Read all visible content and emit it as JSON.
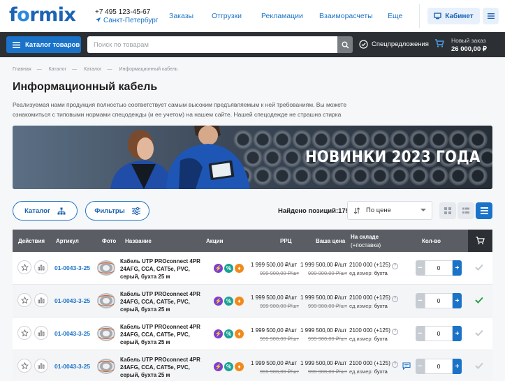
{
  "brand": {
    "logo_pre": "f",
    "logo_o": "o",
    "logo_post": "rmix"
  },
  "contacts": {
    "phone": "+7 495 123-45-67",
    "city": "Санкт-Петербург"
  },
  "nav": {
    "items": [
      "Заказы",
      "Отгрузки",
      "Рекламации",
      "Взаиморасчеты",
      "Еще"
    ]
  },
  "account": {
    "cabinet_label": "Кабинет"
  },
  "toolbar": {
    "catalog_label": "Каталог товаров",
    "search_placeholder": "Поиск по товарам",
    "special_label": "Спецпредложения",
    "order_label": "Новый заказ",
    "order_sum": "26 000,00 ₽"
  },
  "breadcrumbs": [
    "Главная",
    "Каталог",
    "Каталог",
    "Информационный кабель"
  ],
  "page": {
    "title": "Информационный кабель",
    "description": "Реализуемая нами продукция полностью соответствует самым высоким предъявляемым к ней требованиям. Вы можете ознакомиться с типовыми нормами спецодежды (и ее учетом) на нашем сайте. Нашей спецодежде не страшна стирка"
  },
  "banner": {
    "text": "НОВИНКИ 2023 ГОДА"
  },
  "filters": {
    "catalog_label": "Каталог",
    "filters_label": "Фильтры",
    "found_label": "Найдено позиций:",
    "found_count": "179",
    "sort_value": "По цене"
  },
  "table": {
    "headers": {
      "actions": "Действия",
      "sku": "Артикул",
      "photo": "Фото",
      "name": "Название",
      "promo": "Акции",
      "rrp": "РРЦ",
      "your_price": "Ваша цена",
      "stock_line1": "На складе",
      "stock_line2": "(+поставка)",
      "qty": "Кол-во"
    },
    "rows": [
      {
        "sku": "01-0043-3-25",
        "name": "Кабель UTP PROconnect 4PR 24AFG, CCA, CAT5e, PVC, серый, бухта 25 м",
        "rrp": "1 999 500,00 ₽/шт",
        "rrp_old": "999 900,00 ₽/шт",
        "price": "1 999 500,00 ₽/шт",
        "price_old": "999 900,00 ₽/шт",
        "stock": "2100 000 (+125)",
        "unit_label": "ед.измер:",
        "unit": "бухта",
        "qty": "0",
        "in_cart": false,
        "has_chat": false
      },
      {
        "sku": "01-0043-3-25",
        "name": "Кабель UTP PROconnect 4PR 24AFG, CCA, CAT5e, PVC, серый, бухта 25 м",
        "rrp": "1 999 500,00 ₽/шт",
        "rrp_old": "999 900,00 ₽/шт",
        "price": "1 999 500,00 ₽/шт",
        "price_old": "999 900,00 ₽/шт",
        "stock": "2100 000 (+125)",
        "unit_label": "ед.измер:",
        "unit": "бухта",
        "qty": "0",
        "in_cart": true,
        "has_chat": false
      },
      {
        "sku": "01-0043-3-25",
        "name": "Кабель UTP PROconnect 4PR 24AFG, CCA, CAT5e, PVC, серый, бухта 25 м",
        "rrp": "1 999 500,00 ₽/шт",
        "rrp_old": "999 900,00 ₽/шт",
        "price": "1 999 500,00 ₽/шт",
        "price_old": "999 900,00 ₽/шт",
        "stock": "2100 000 (+125)",
        "unit_label": "ед.измер:",
        "unit": "бухта",
        "qty": "0",
        "in_cart": false,
        "has_chat": false
      },
      {
        "sku": "01-0043-3-25",
        "name": "Кабель UTP PROconnect 4PR 24AFG, CCA, CAT5e, PVC, серый, бухта 25 м",
        "rrp": "1 999 500,00 ₽/шт",
        "rrp_old": "999 900,00 ₽/шт",
        "price": "1 999 500,00 ₽/шт",
        "price_old": "999 900,00 ₽/шт",
        "stock": "2100 000 (+125)",
        "unit_label": "ед.измер:",
        "unit": "бухта",
        "qty": "0",
        "in_cart": false,
        "has_chat": true
      }
    ]
  },
  "colors": {
    "accent": "#1a73c9",
    "dark_bar": "#2c2f33",
    "promo_purple": "#7b3fd3",
    "promo_teal": "#1aa394",
    "promo_orange": "#f08a1a",
    "check_green": "#2ea043"
  }
}
